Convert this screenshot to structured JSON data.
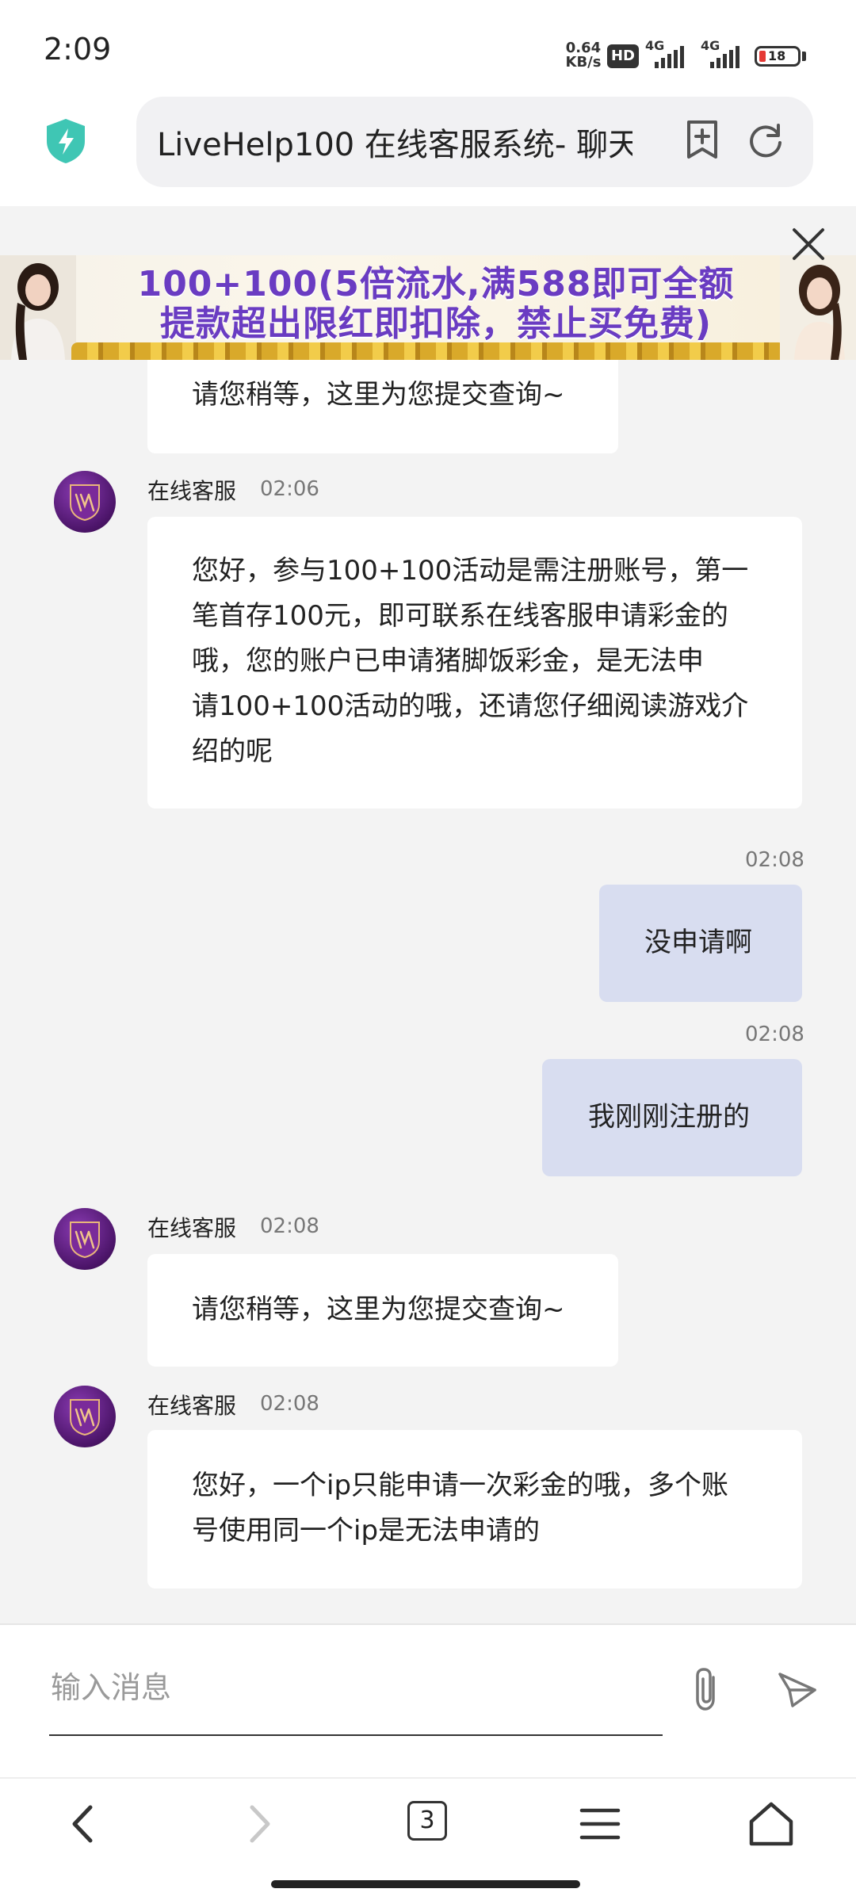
{
  "status_bar": {
    "time": "2:09",
    "net_speed_value": "0.64",
    "net_speed_unit": "KB/s",
    "hd_badge": "HD",
    "signal1_label": "4G",
    "signal2_label": "4G",
    "battery": "18"
  },
  "browser": {
    "url_title": "LiveHelp100 在线客服系统- 聊天",
    "icons": [
      "shield-bolt-icon",
      "add-bookmark-icon",
      "refresh-icon"
    ]
  },
  "ad_banner": {
    "line1": "100+100(5倍流水,满588即可全额",
    "line2": "提款超出限红即扣除，禁止买免费)"
  },
  "messages": [
    {
      "from": "agent",
      "sender": "",
      "time": "",
      "text": "请您稍等，这里为您提交查询~",
      "partial": true
    },
    {
      "from": "agent",
      "sender": "在线客服",
      "time": "02:06",
      "lines": [
        "您好，参与100+100活动是需注册账号，第一",
        "笔首存100元，即可联系在线客服申请彩金的",
        "哦，您的账户已申请猪脚饭彩金，是无法申",
        "请100+100活动的哦，还请您仔细阅读游戏介",
        "绍的呢"
      ]
    },
    {
      "from": "me",
      "time": "02:08",
      "text": "没申请啊"
    },
    {
      "from": "me",
      "time": "02:08",
      "text": "我刚刚注册的"
    },
    {
      "from": "agent",
      "sender": "在线客服",
      "time": "02:08",
      "text": "请您稍等，这里为您提交查询~"
    },
    {
      "from": "agent",
      "sender": "在线客服",
      "time": "02:08",
      "lines": [
        "您好，一个ip只能申请一次彩金的哦，多个账",
        "号使用同一个ip是无法申请的"
      ]
    }
  ],
  "input": {
    "placeholder": "输入消息",
    "value": ""
  },
  "nav": {
    "tab_count": "3"
  },
  "colors": {
    "agent_bubble": "#ffffff",
    "my_bubble": "#d8ddf0",
    "ad_text": "#6a3cc2",
    "avatar": "#4b1468"
  }
}
